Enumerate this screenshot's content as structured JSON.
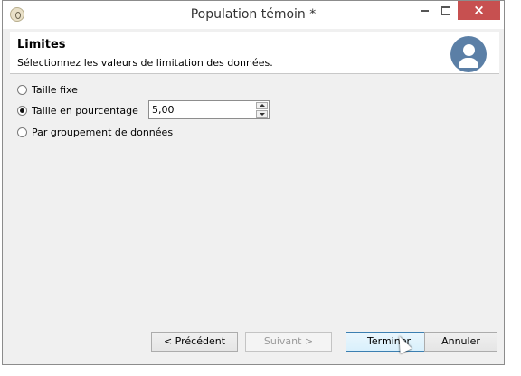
{
  "window": {
    "title": "Population témoin *",
    "close_glyph": "×"
  },
  "header": {
    "title": "Limites",
    "subtitle": "Sélectionnez les valeurs de limitation des données."
  },
  "options": {
    "fixed_size": {
      "label": "Taille fixe",
      "selected": false
    },
    "percentage_size": {
      "label": "Taille en pourcentage",
      "selected": true,
      "value": "5,00"
    },
    "data_grouping": {
      "label": "Par groupement de données",
      "selected": false
    }
  },
  "buttons": {
    "previous": {
      "label": "< Précédent",
      "enabled": true
    },
    "next": {
      "label": "Suivant >",
      "enabled": false
    },
    "finish": {
      "label": "Terminer",
      "enabled": true
    },
    "cancel": {
      "label": "Annuler",
      "enabled": true
    }
  },
  "colors": {
    "close_button": "#c75050",
    "avatar": "#5b7fa6"
  },
  "icons": [
    "app-icon",
    "minimize-icon",
    "maximize-icon",
    "close-icon",
    "user-avatar-icon",
    "cursor-icon"
  ]
}
